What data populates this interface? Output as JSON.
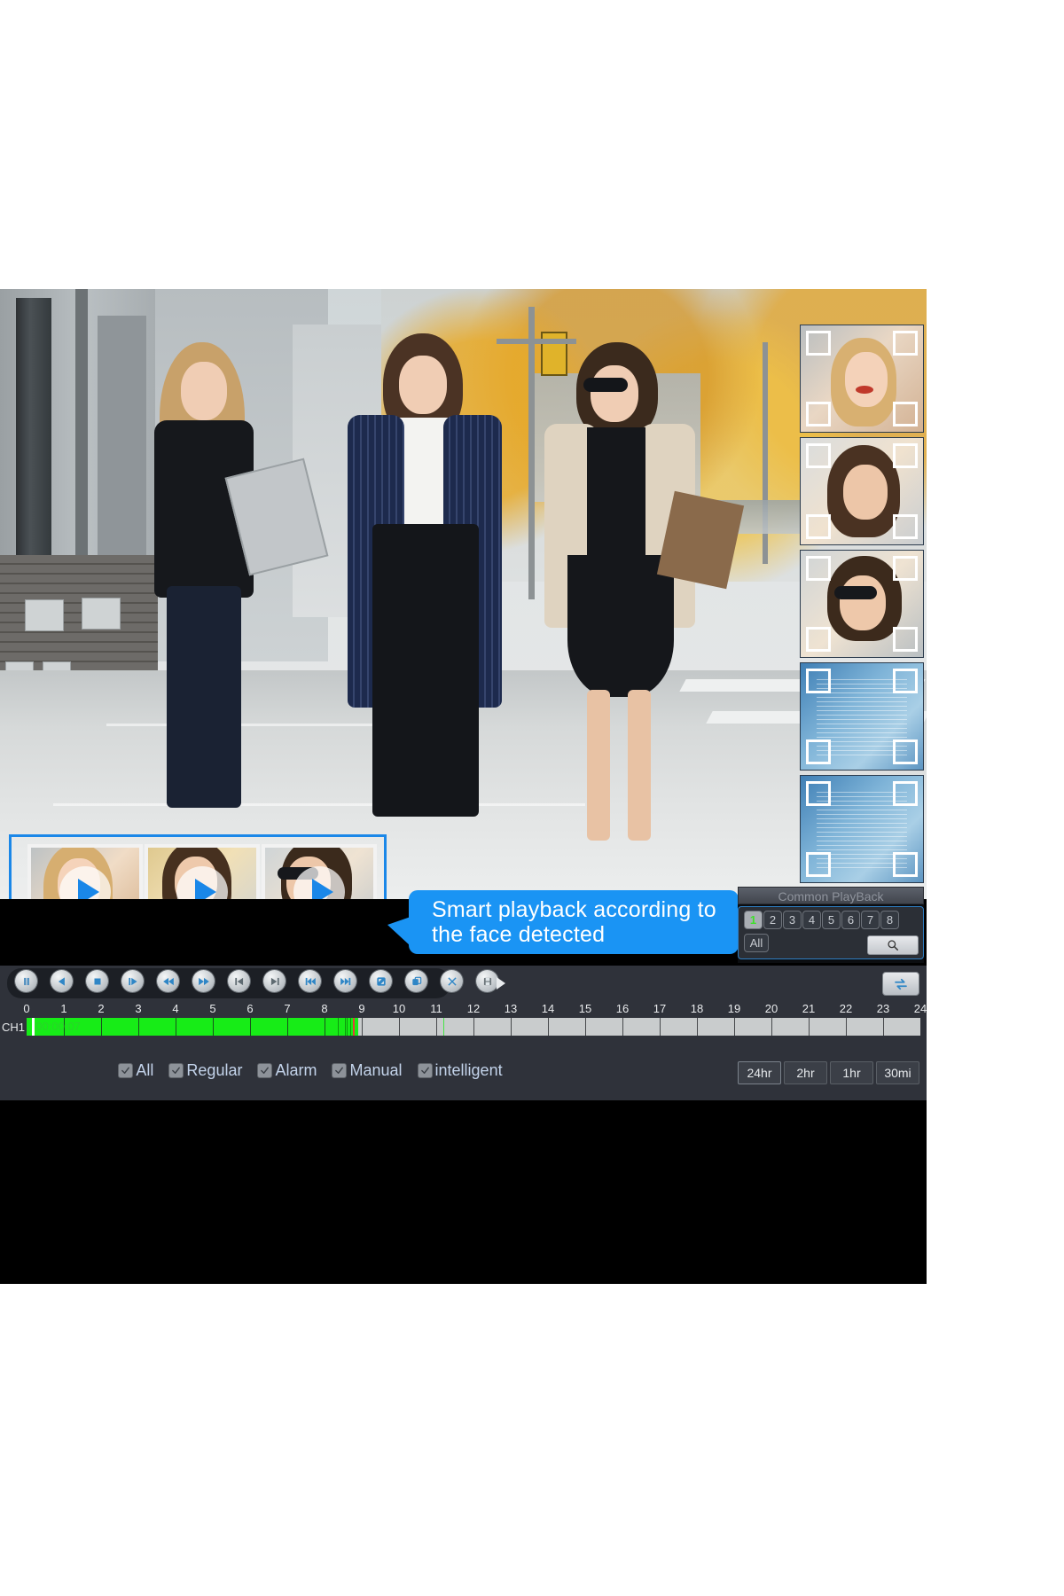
{
  "callout": {
    "line1": "Smart playback according to",
    "line2": "the face detected"
  },
  "common_playback": {
    "title": "Common PlayBack",
    "channels": [
      "1",
      "2",
      "3",
      "4",
      "5",
      "6",
      "7",
      "8"
    ],
    "selected_channel": "1",
    "all_label": "All",
    "search_icon": "search-icon"
  },
  "toolbar": {
    "buttons": [
      {
        "name": "pause-button",
        "icon": "pause-icon"
      },
      {
        "name": "reverse-play-button",
        "icon": "triangle-left-icon"
      },
      {
        "name": "stop-button",
        "icon": "square-icon"
      },
      {
        "name": "play-button",
        "icon": "play-bar-icon"
      },
      {
        "name": "slow-backward-button",
        "icon": "double-triangle-left-icon"
      },
      {
        "name": "fast-forward-button",
        "icon": "double-triangle-right-icon"
      },
      {
        "name": "previous-frame-button",
        "icon": "skip-start-icon"
      },
      {
        "name": "next-frame-button",
        "icon": "skip-end-icon"
      },
      {
        "name": "previous-file-button",
        "icon": "prev-track-icon"
      },
      {
        "name": "next-file-button",
        "icon": "next-track-icon"
      },
      {
        "name": "full-screen-button",
        "icon": "expand-icon"
      },
      {
        "name": "digital-zoom-button",
        "icon": "copy-icon"
      },
      {
        "name": "clip-button",
        "icon": "scissors-icon"
      },
      {
        "name": "backup-button",
        "icon": "save-disk-icon"
      }
    ],
    "more_icon": "triangle-right-icon",
    "sync_icon": "sync-arrows-icon"
  },
  "timeline": {
    "channel_label": "CH1",
    "cursor_time": "00:00:07",
    "ticks": [
      "0",
      "1",
      "2",
      "3",
      "4",
      "5",
      "6",
      "7",
      "8",
      "9",
      "10",
      "11",
      "12",
      "13",
      "14",
      "15",
      "16",
      "17",
      "18",
      "19",
      "20",
      "21",
      "22",
      "23",
      "24"
    ],
    "range_hours": 24,
    "recorded_end_hour": 8.9,
    "playhead_hour": 8.75,
    "cursor_hour": 0.15,
    "intelligent_marks_hours": [
      8.35,
      8.55,
      8.6,
      8.68,
      8.75,
      11.2
    ],
    "track_color": "#17ec17",
    "empty_color": "#c9cccd"
  },
  "filters": {
    "items": [
      {
        "label": "All",
        "checked": true
      },
      {
        "label": "Regular",
        "checked": true
      },
      {
        "label": "Alarm",
        "checked": true
      },
      {
        "label": "Manual",
        "checked": true
      },
      {
        "label": "intelligent",
        "checked": true
      }
    ]
  },
  "time_ranges": {
    "buttons": [
      "24hr",
      "2hr",
      "1hr",
      "30mi"
    ],
    "selected": "24hr"
  },
  "face_panel": {
    "thumbnails": [
      {
        "name": "face-snapshot-1",
        "kind": "photo",
        "tone": "#e8c4a6"
      },
      {
        "name": "face-snapshot-2",
        "kind": "photo",
        "tone": "#d9b08c"
      },
      {
        "name": "face-snapshot-3",
        "kind": "photo",
        "tone": "#e2bfa0"
      },
      {
        "name": "face-snapshot-4",
        "kind": "analysis",
        "tone": "#6fa8cd"
      },
      {
        "name": "face-snapshot-5",
        "kind": "analysis",
        "tone": "#6fa8cd"
      }
    ]
  },
  "smart_strip": {
    "border_color": "#1a87e8",
    "clips": [
      {
        "name": "smart-clip-1",
        "play_icon": "play-icon"
      },
      {
        "name": "smart-clip-2",
        "play_icon": "play-icon"
      },
      {
        "name": "smart-clip-3",
        "play_icon": "play-icon"
      }
    ]
  },
  "accent_colors": {
    "blue": "#1a94f4",
    "green": "#17ec17",
    "panel": "#2f323a"
  }
}
